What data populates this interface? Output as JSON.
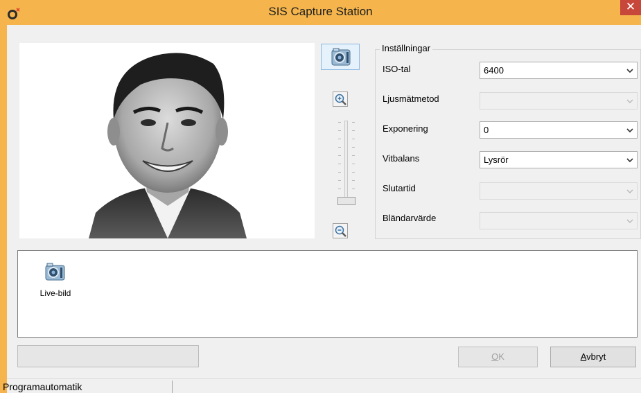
{
  "window": {
    "title": "SIS Capture Station",
    "close_symbol": "✕",
    "icon": "app-logo-icon",
    "colors": {
      "titlebar": "#f5b54c",
      "close": "#c7473b"
    }
  },
  "toolbar": {
    "camera_icon": "camera-icon",
    "zoom_in_icon": "zoom-in-icon",
    "zoom_out_icon": "zoom-out-icon",
    "zoom_level": 0
  },
  "settings": {
    "group_title": "Inställningar",
    "fields": [
      {
        "label": "ISO-tal",
        "value": "6400",
        "enabled": true
      },
      {
        "label": "Ljusmätmetod",
        "value": "",
        "enabled": false
      },
      {
        "label": "Exponering",
        "value": "0",
        "enabled": true
      },
      {
        "label": "Vitbalans",
        "value": "Lysrör",
        "enabled": true
      },
      {
        "label": "Slutartid",
        "value": "",
        "enabled": false
      },
      {
        "label": "Bländarvärde",
        "value": "",
        "enabled": false
      }
    ]
  },
  "thumbnails": {
    "items": [
      {
        "label": "Live-bild",
        "icon": "camera-icon"
      }
    ]
  },
  "buttons": {
    "ok_mnemonic": "O",
    "ok_rest": "K",
    "cancel_mnemonic": "A",
    "cancel_rest": "vbryt"
  },
  "status": {
    "text": "Programautomatik"
  }
}
